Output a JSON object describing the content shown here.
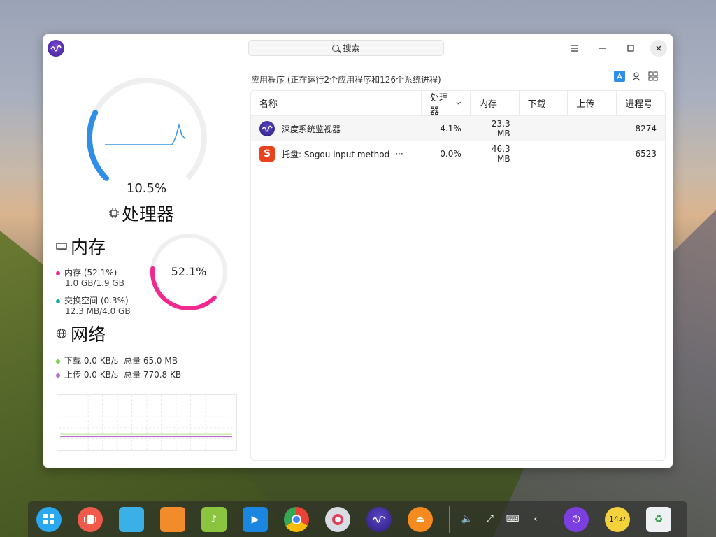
{
  "window": {
    "search_label": "搜索",
    "menu_icon": "hamburger-icon",
    "minimize_icon": "minimize-icon",
    "maximize_icon": "maximize-icon",
    "close_icon": "close-icon"
  },
  "cpu": {
    "percent_label": "10.5%",
    "percent_value": 10.5,
    "title": "处理器",
    "ring_color": "#2f8fe6"
  },
  "memory": {
    "title": "内存",
    "percent_label": "52.1%",
    "percent_value": 52.1,
    "ring_color": "#f0288f",
    "mem_label": "内存 (52.1%)",
    "mem_value": "1.0 GB/1.9 GB",
    "swap_label": "交换空间 (0.3%)",
    "swap_value": "12.3 MB/4.0 GB",
    "mem_color": "#f0288f",
    "swap_color": "#1aa7b8"
  },
  "network": {
    "title": "网络",
    "download_label": "下载 0.0 KB/s",
    "download_total": "总量 65.0 MB",
    "upload_label": "上传 0.0 KB/s",
    "upload_total": "总量 770.8 KB",
    "download_color": "#7ad14a",
    "upload_color": "#b76fd6"
  },
  "processes": {
    "header": "应用程序 (正在运行2个应用程序和126个系统进程)",
    "columns": {
      "name": "名称",
      "cpu": "处理器",
      "mem": "内存",
      "download": "下载",
      "upload": "上传",
      "pid": "进程号"
    },
    "rows": [
      {
        "name": "深度系统监视器",
        "cpu": "4.1%",
        "mem": "23.3 MB",
        "download": "",
        "upload": "",
        "pid": "8274"
      },
      {
        "name": "托盘: Sogou input method",
        "more": "···",
        "cpu": "0.0%",
        "mem": "46.3 MB",
        "download": "",
        "upload": "",
        "pid": "6523"
      }
    ]
  },
  "dock": {
    "clock_hour": "14",
    "clock_min": "37"
  }
}
